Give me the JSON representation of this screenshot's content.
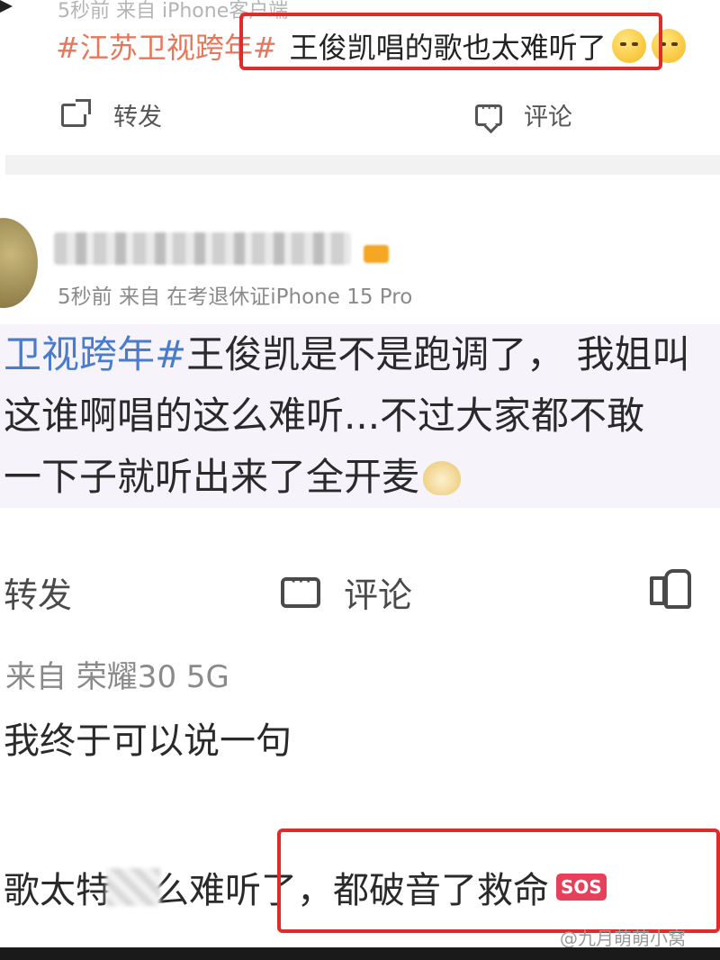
{
  "post1": {
    "meta": "5秒前 来自 iPhone客户端",
    "hashtag": "#江苏卫视跨年#",
    "text": "王俊凯唱的歌也太难听了",
    "emoji": [
      "cry-laugh-emoji",
      "cry-laugh-emoji"
    ],
    "actions": {
      "share": "转发",
      "comment": "评论"
    }
  },
  "post2": {
    "meta": "5秒前  来自 在考退休证iPhone 15 Pro",
    "body_lines": [
      {
        "hashtag": "卫视跨年#",
        "text": "王俊凯是不是跑调了，  我姐叫"
      },
      {
        "text": "这谁啊唱的这么难听...不过大家都不敢"
      },
      {
        "text": "一下子就听出来了全开麦"
      }
    ],
    "actions": {
      "share": "转发",
      "comment": "评论"
    }
  },
  "comment3": {
    "meta": "来自 荣耀30 5G",
    "line1": "我终于可以说一句",
    "line2_pre": "歌太特",
    "line2_post": "么难听了，都破音了救命",
    "badge": "SOS"
  },
  "watermark": "@九月萌萌小窝",
  "colors": {
    "highlight_box": "#e02b2b",
    "hashtag_orange": "#e8765a",
    "hashtag_blue": "#4a7cc9",
    "sos": "#e83f5a"
  }
}
